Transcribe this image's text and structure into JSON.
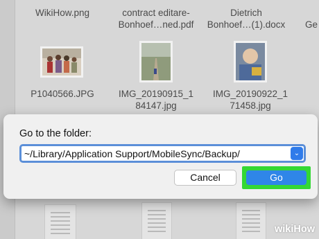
{
  "files_top": [
    {
      "label": "WikiHow.png"
    },
    {
      "label": "contract editare-\nBonhoef…ned.pdf"
    },
    {
      "label": "Dietrich\nBonhoef…(1).docx"
    },
    {
      "label": "Ge"
    }
  ],
  "files_photos": [
    {
      "label": "P1040566.JPG"
    },
    {
      "label": "IMG_20190915_1\n84147.jpg"
    },
    {
      "label": "IMG_20190922_1\n71458.jpg"
    }
  ],
  "dialog": {
    "label": "Go to the folder:",
    "path_value": "~/Library/Application Support/MobileSync/Backup/",
    "dropdown_icon": "chevron-down-icon",
    "cancel_label": "Cancel",
    "go_label": "Go",
    "highlight_color": "#34d834",
    "accent_color": "#2f86e8"
  },
  "watermark": {
    "prefix": "wiki",
    "suffix": "How"
  }
}
